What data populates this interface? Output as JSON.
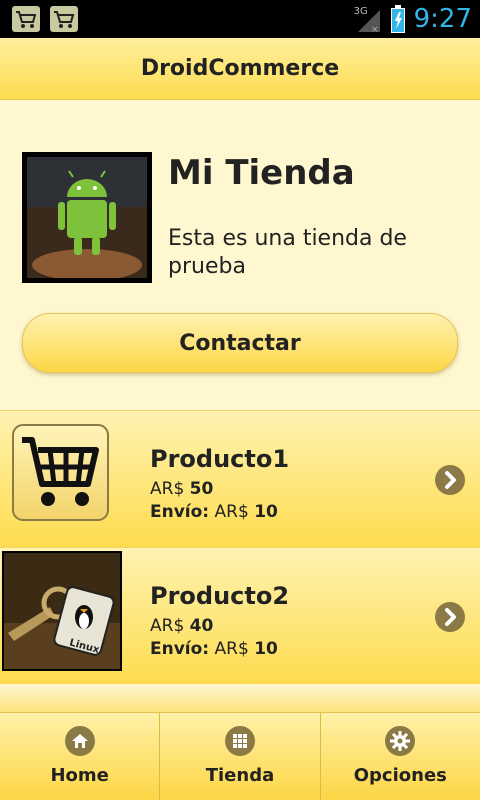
{
  "status_bar": {
    "network": "3G",
    "time": "9:27",
    "notifications": [
      "cart-icon",
      "cart-icon"
    ]
  },
  "header": {
    "title": "DroidCommerce"
  },
  "store": {
    "name": "Mi Tienda",
    "description": "Esta es una tienda de prueba",
    "contact_label": "Contactar"
  },
  "products": [
    {
      "name": "Producto1",
      "price_currency": "AR$",
      "price": "50",
      "shipping_label": "Envío:",
      "shipping_currency": "AR$",
      "shipping": "10",
      "icon": "shopping-cart-icon"
    },
    {
      "name": "Producto2",
      "price_currency": "AR$",
      "price": "40",
      "shipping_label": "Envío:",
      "shipping_currency": "AR$",
      "shipping": "10",
      "icon": "linux-keychain-photo"
    }
  ],
  "tabs": [
    {
      "label": "Home",
      "icon": "home-icon"
    },
    {
      "label": "Tienda",
      "icon": "grid-icon"
    },
    {
      "label": "Opciones",
      "icon": "gear-icon"
    }
  ],
  "colors": {
    "accent": "#fdd645",
    "time": "#33b5e5",
    "chevron": "#8b7a45"
  }
}
